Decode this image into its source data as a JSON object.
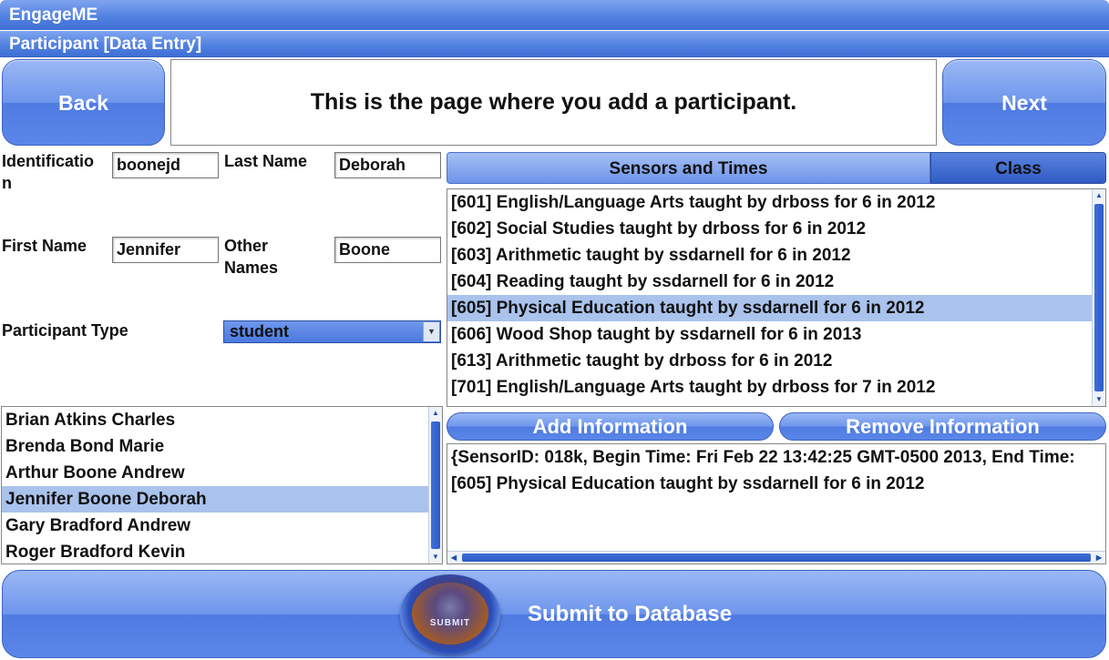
{
  "app": {
    "title": "EngageME",
    "subtitle": "Participant [Data Entry]"
  },
  "nav": {
    "back_label": "Back",
    "next_label": "Next",
    "message": "This is the page where you add a participant."
  },
  "form": {
    "identification_label": "Identificatio\nn",
    "identification_value": "boonejd",
    "last_name_label": "Last Name",
    "last_name_value": "Deborah",
    "first_name_label": "First Name",
    "first_name_value": "Jennifer",
    "other_names_label": "Other\nNames",
    "other_names_value": "Boone",
    "participant_type_label": "Participant Type",
    "participant_type_value": "student"
  },
  "participants": {
    "items": [
      "Brian Atkins Charles",
      "Brenda Bond Marie",
      "Arthur Boone Andrew",
      "Jennifer Boone Deborah",
      "Gary Bradford Andrew",
      "Roger Bradford Kevin"
    ],
    "selected_index": 3
  },
  "tabs": {
    "sensors_label": "Sensors and Times",
    "class_label": "Class"
  },
  "classes": {
    "items": [
      "[601] English/Language Arts taught by drboss for 6 in 2012",
      "[602] Social Studies taught by drboss for 6 in 2012",
      "[603] Arithmetic taught by ssdarnell for 6 in 2012",
      "[604] Reading taught by ssdarnell for 6 in 2012",
      "[605] Physical Education taught by ssdarnell for 6 in 2012",
      "[606] Wood Shop taught by ssdarnell for 6 in 2013",
      "[613] Arithmetic taught by drboss for 6 in 2012",
      "[701] English/Language Arts taught by drboss for 7 in 2012"
    ],
    "selected_index": 4
  },
  "actions": {
    "add_label": "Add Information",
    "remove_label": "Remove Information"
  },
  "info": {
    "items": [
      "{SensorID: 018k, Begin Time: Fri Feb 22 13:42:25 GMT-0500 2013, End Time:",
      "[605] Physical Education taught by ssdarnell for 6 in 2012"
    ]
  },
  "submit": {
    "icon_text": "SUBMIT",
    "label": "Submit to Database"
  }
}
